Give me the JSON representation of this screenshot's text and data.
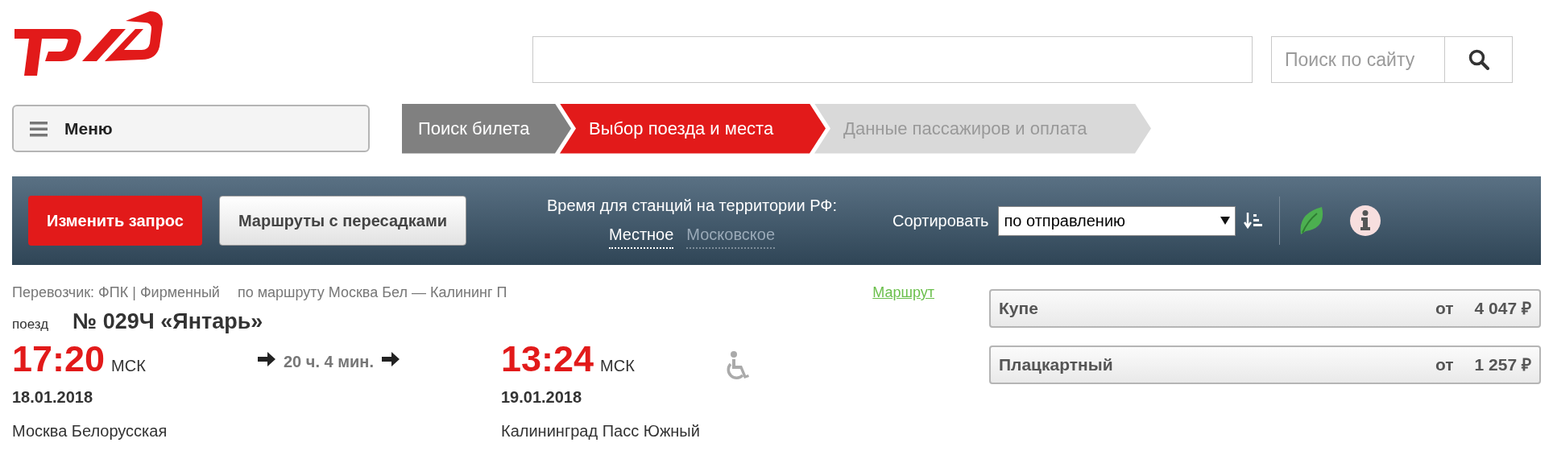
{
  "header": {
    "site_search": {
      "placeholder": "Поиск по сайту"
    }
  },
  "menu_button": {
    "label": "Меню"
  },
  "steps": [
    {
      "label": "Поиск билета",
      "completed": true,
      "selected": false
    },
    {
      "label": "Выбор поезда и места",
      "completed": false,
      "selected": true
    },
    {
      "label": "Данные пассажиров и оплата",
      "completed": false,
      "selected": false
    }
  ],
  "toolbar": {
    "change_button": "Изменить запрос",
    "transfers_button": "Маршруты с пересадками",
    "time_label": "Время для станций на территории РФ:",
    "time_options": [
      {
        "label": "Местное",
        "selected": true
      },
      {
        "label": "Московское",
        "selected": false
      }
    ],
    "sort_label": "Сортировать",
    "sort_value": "по отправлению"
  },
  "train": {
    "carrier": "Перевозчик: ФПК | Фирменный",
    "route": "по маршруту Москва Бел — Калининг П",
    "route_link": "Маршрут",
    "prefix": "поезд",
    "name": "№ 029Ч «Янтарь»",
    "departure": {
      "time": "17:20",
      "zone": "МСК",
      "date": "18.01.2018",
      "station": "Москва Белорусская"
    },
    "duration": "20 ч. 4 мин.",
    "arrival": {
      "time": "13:24",
      "zone": "МСК",
      "date": "19.01.2018",
      "station": "Калининград Пасс Южный"
    },
    "accessible": true
  },
  "fares": [
    {
      "class": "Купе",
      "from": "от",
      "price": "4 047 ₽"
    },
    {
      "class": "Плацкартный",
      "from": "от",
      "price": "1 257 ₽"
    }
  ]
}
